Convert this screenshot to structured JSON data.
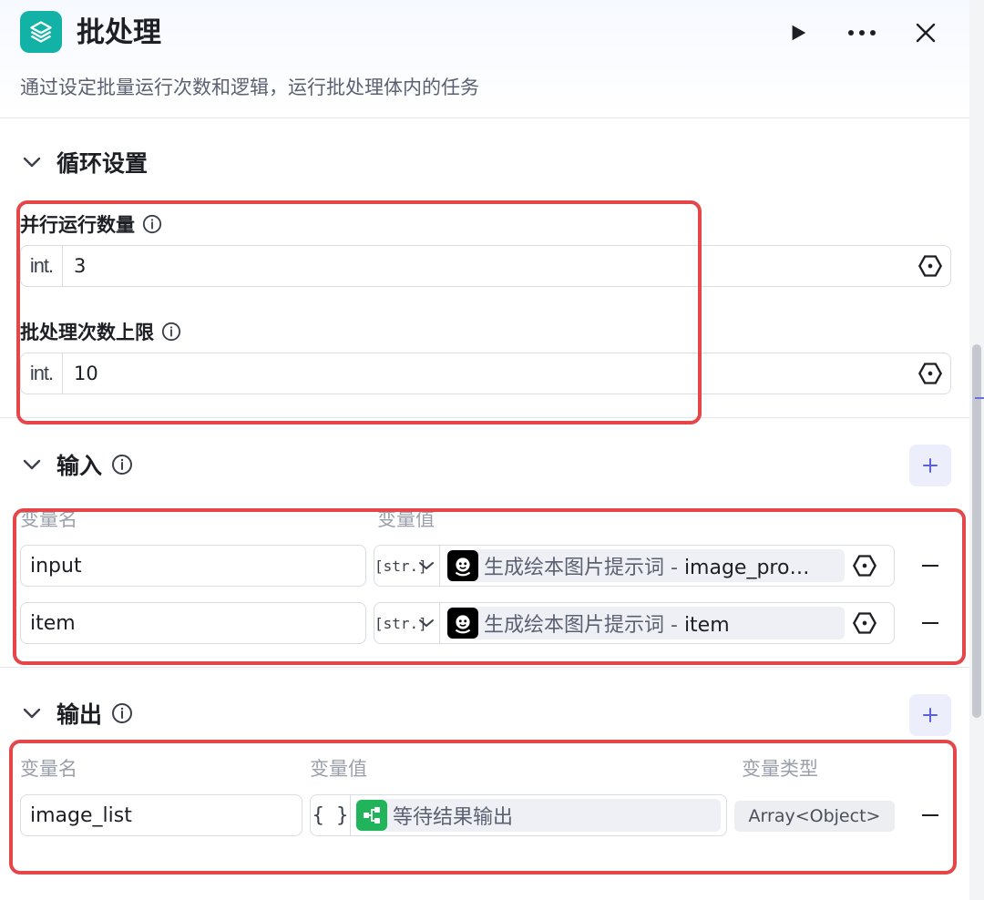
{
  "header": {
    "title": "批处理",
    "description": "通过设定批量运行次数和逻辑，运行批处理体内的任务",
    "icon": "layers-icon",
    "accent": "#12b3a6"
  },
  "loop_settings": {
    "title": "循环设置",
    "parallel": {
      "label": "并行运行数量",
      "type": "int.",
      "value": "3"
    },
    "limit": {
      "label": "批处理次数上限",
      "type": "int.",
      "value": "10"
    }
  },
  "input_section": {
    "title": "输入",
    "col_name": "变量名",
    "col_value": "变量值",
    "rows": [
      {
        "name": "input",
        "type": "[str.]",
        "source": "生成绘本图片提示词 - ",
        "field": "image_pro…"
      },
      {
        "name": "item",
        "type": "[str.]",
        "source": "生成绘本图片提示词 - ",
        "field": "item"
      }
    ]
  },
  "output_section": {
    "title": "输出",
    "col_name": "变量名",
    "col_value": "变量值",
    "col_type": "变量类型",
    "rows": [
      {
        "name": "image_list",
        "type": "{ }",
        "source": "等待结果输出",
        "var_type": "Array<Object>"
      }
    ]
  },
  "colors": {
    "highlight_box": "#e4474a",
    "plus_bg": "#eceefc",
    "plus_icon": "#5b5fd6"
  }
}
